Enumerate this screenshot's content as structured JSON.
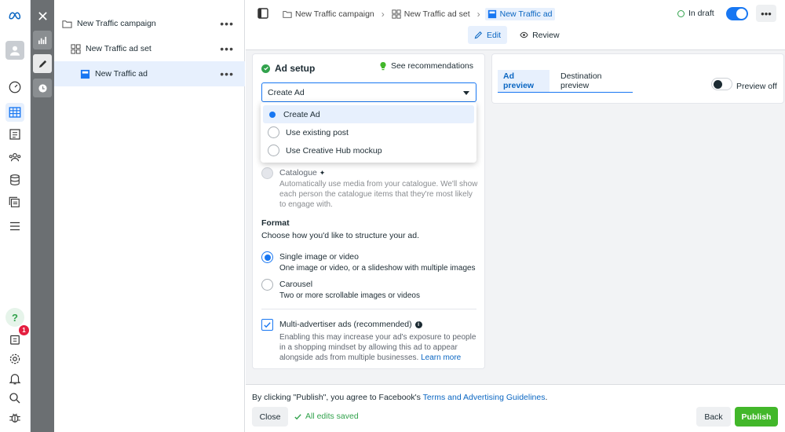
{
  "tree": {
    "campaign": "New Traffic campaign",
    "adset": "New Traffic ad set",
    "ad": "New Traffic ad"
  },
  "breadcrumb": [
    "New Traffic campaign",
    "New Traffic ad set",
    "New Traffic ad"
  ],
  "status": {
    "label": "In draft"
  },
  "tabs": {
    "edit": "Edit",
    "review": "Review"
  },
  "ad_setup": {
    "title": "Ad setup",
    "see_recommendations": "See recommendations",
    "select_value": "Create Ad",
    "options": [
      "Create Ad",
      "Use existing post",
      "Use Creative Hub mockup"
    ]
  },
  "catalogue": {
    "title": "Catalogue",
    "desc": "Automatically use media from your catalogue. We'll show each person the catalogue items that they're most likely to engage with."
  },
  "format": {
    "heading": "Format",
    "desc": "Choose how you'd like to structure your ad.",
    "single_title": "Single image or video",
    "single_desc": "One image or video, or a slideshow with multiple images",
    "carousel_title": "Carousel",
    "carousel_desc": "Two or more scrollable images or videos"
  },
  "multi_advertiser": {
    "title": "Multi-advertiser ads (recommended)",
    "desc": "Enabling this may increase your ad's exposure to people in a shopping mindset by allowing this ad to appear alongside ads from multiple businesses.",
    "learn_more": "Learn more"
  },
  "preview": {
    "tab_ad": "Ad preview",
    "tab_dest": "Destination preview",
    "toggle_label": "Preview off"
  },
  "footer": {
    "terms_prefix": "By clicking \"Publish\", you agree to Facebook's ",
    "terms_link": "Terms and Advertising Guidelines",
    "terms_suffix": ".",
    "close": "Close",
    "saved": "All edits saved",
    "back": "Back",
    "publish": "Publish"
  },
  "rail": {
    "badge_count": "1"
  },
  "colors": {
    "accent": "#1877f2",
    "publish": "#42b72a",
    "success": "#31a24c"
  }
}
